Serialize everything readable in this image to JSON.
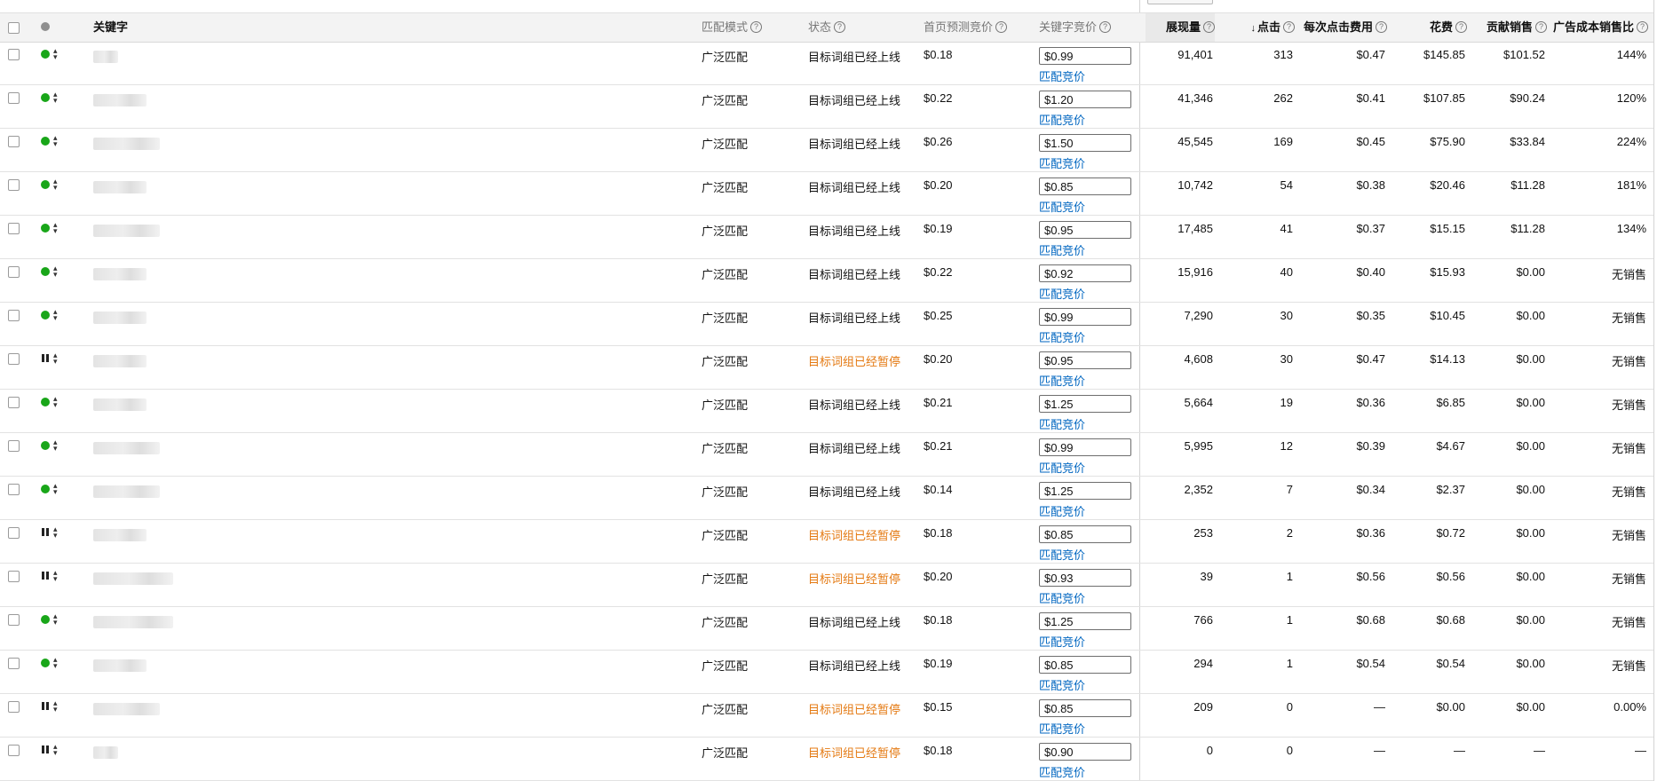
{
  "header": {
    "keyword": "关键字",
    "match_type": "匹配模式",
    "status": "状态",
    "suggested_bid": "首页预测竞价",
    "keyword_bid": "关键字竞价",
    "impressions": "展现量",
    "clicks": "点击",
    "cpc": "每次点击费用",
    "spend": "花费",
    "sales": "贡献销售",
    "acos": "广告成本销售比",
    "help_glyph": "?",
    "sort_glyph": "↓"
  },
  "bid_link_label": "匹配竞价",
  "rows": [
    {
      "state": "active",
      "kw_w": 28,
      "match": "广泛匹配",
      "status": "目标词组已经上线",
      "suggested": "$0.18",
      "bid": "$0.99",
      "link": "匹配竞价",
      "impressions": "91,401",
      "clicks": "313",
      "cpc": "$0.47",
      "spend": "$145.85",
      "sales": "$101.52",
      "acos": "144%"
    },
    {
      "state": "active",
      "kw_w": 60,
      "match": "广泛匹配",
      "status": "目标词组已经上线",
      "suggested": "$0.22",
      "bid": "$1.20",
      "link": "匹配竞价",
      "impressions": "41,346",
      "clicks": "262",
      "cpc": "$0.41",
      "spend": "$107.85",
      "sales": "$90.24",
      "acos": "120%"
    },
    {
      "state": "active",
      "kw_w": 75,
      "match": "广泛匹配",
      "status": "目标词组已经上线",
      "suggested": "$0.26",
      "bid": "$1.50",
      "link": "匹配竞价",
      "impressions": "45,545",
      "clicks": "169",
      "cpc": "$0.45",
      "spend": "$75.90",
      "sales": "$33.84",
      "acos": "224%"
    },
    {
      "state": "active",
      "kw_w": 60,
      "match": "广泛匹配",
      "status": "目标词组已经上线",
      "suggested": "$0.20",
      "bid": "$0.85",
      "link": "匹配竞价",
      "impressions": "10,742",
      "clicks": "54",
      "cpc": "$0.38",
      "spend": "$20.46",
      "sales": "$11.28",
      "acos": "181%"
    },
    {
      "state": "active",
      "kw_w": 75,
      "match": "广泛匹配",
      "status": "目标词组已经上线",
      "suggested": "$0.19",
      "bid": "$0.95",
      "link": "匹配竞价",
      "impressions": "17,485",
      "clicks": "41",
      "cpc": "$0.37",
      "spend": "$15.15",
      "sales": "$11.28",
      "acos": "134%"
    },
    {
      "state": "active",
      "kw_w": 60,
      "match": "广泛匹配",
      "status": "目标词组已经上线",
      "suggested": "$0.22",
      "bid": "$0.92",
      "link": "匹配竞价",
      "impressions": "15,916",
      "clicks": "40",
      "cpc": "$0.40",
      "spend": "$15.93",
      "sales": "$0.00",
      "acos": "无销售"
    },
    {
      "state": "active",
      "kw_w": 60,
      "match": "广泛匹配",
      "status": "目标词组已经上线",
      "suggested": "$0.25",
      "bid": "$0.99",
      "link": "匹配竞价",
      "impressions": "7,290",
      "clicks": "30",
      "cpc": "$0.35",
      "spend": "$10.45",
      "sales": "$0.00",
      "acos": "无销售"
    },
    {
      "state": "paused",
      "kw_w": 60,
      "match": "广泛匹配",
      "status": "目标词组已经暂停",
      "suggested": "$0.20",
      "bid": "$0.95",
      "link": "匹配竞价",
      "impressions": "4,608",
      "clicks": "30",
      "cpc": "$0.47",
      "spend": "$14.13",
      "sales": "$0.00",
      "acos": "无销售"
    },
    {
      "state": "active",
      "kw_w": 60,
      "match": "广泛匹配",
      "status": "目标词组已经上线",
      "suggested": "$0.21",
      "bid": "$1.25",
      "link": "匹配竞价",
      "impressions": "5,664",
      "clicks": "19",
      "cpc": "$0.36",
      "spend": "$6.85",
      "sales": "$0.00",
      "acos": "无销售"
    },
    {
      "state": "active",
      "kw_w": 75,
      "match": "广泛匹配",
      "status": "目标词组已经上线",
      "suggested": "$0.21",
      "bid": "$0.99",
      "link": "匹配竞价",
      "impressions": "5,995",
      "clicks": "12",
      "cpc": "$0.39",
      "spend": "$4.67",
      "sales": "$0.00",
      "acos": "无销售"
    },
    {
      "state": "active",
      "kw_w": 75,
      "match": "广泛匹配",
      "status": "目标词组已经上线",
      "suggested": "$0.14",
      "bid": "$1.25",
      "link": "匹配竞价",
      "impressions": "2,352",
      "clicks": "7",
      "cpc": "$0.34",
      "spend": "$2.37",
      "sales": "$0.00",
      "acos": "无销售"
    },
    {
      "state": "paused",
      "kw_w": 60,
      "match": "广泛匹配",
      "status": "目标词组已经暂停",
      "suggested": "$0.18",
      "bid": "$0.85",
      "link": "匹配竞价",
      "impressions": "253",
      "clicks": "2",
      "cpc": "$0.36",
      "spend": "$0.72",
      "sales": "$0.00",
      "acos": "无销售"
    },
    {
      "state": "paused",
      "kw_w": 90,
      "match": "广泛匹配",
      "status": "目标词组已经暂停",
      "suggested": "$0.20",
      "bid": "$0.93",
      "link": "匹配竞价",
      "impressions": "39",
      "clicks": "1",
      "cpc": "$0.56",
      "spend": "$0.56",
      "sales": "$0.00",
      "acos": "无销售"
    },
    {
      "state": "active",
      "kw_w": 90,
      "match": "广泛匹配",
      "status": "目标词组已经上线",
      "suggested": "$0.18",
      "bid": "$1.25",
      "link": "匹配竞价",
      "impressions": "766",
      "clicks": "1",
      "cpc": "$0.68",
      "spend": "$0.68",
      "sales": "$0.00",
      "acos": "无销售"
    },
    {
      "state": "active",
      "kw_w": 60,
      "match": "广泛匹配",
      "status": "目标词组已经上线",
      "suggested": "$0.19",
      "bid": "$0.85",
      "link": "匹配竞价",
      "impressions": "294",
      "clicks": "1",
      "cpc": "$0.54",
      "spend": "$0.54",
      "sales": "$0.00",
      "acos": "无销售"
    },
    {
      "state": "paused",
      "kw_w": 75,
      "match": "广泛匹配",
      "status": "目标词组已经暂停",
      "suggested": "$0.15",
      "bid": "$0.85",
      "link": "匹配竞价",
      "impressions": "209",
      "clicks": "0",
      "cpc": "—",
      "spend": "$0.00",
      "sales": "$0.00",
      "acos": "0.00%"
    },
    {
      "state": "paused",
      "kw_w": 28,
      "match": "广泛匹配",
      "status": "目标词组已经暂停",
      "suggested": "$0.18",
      "bid": "$0.90",
      "link": "匹配竞价",
      "impressions": "0",
      "clicks": "0",
      "cpc": "—",
      "spend": "—",
      "sales": "—",
      "acos": "—"
    }
  ]
}
